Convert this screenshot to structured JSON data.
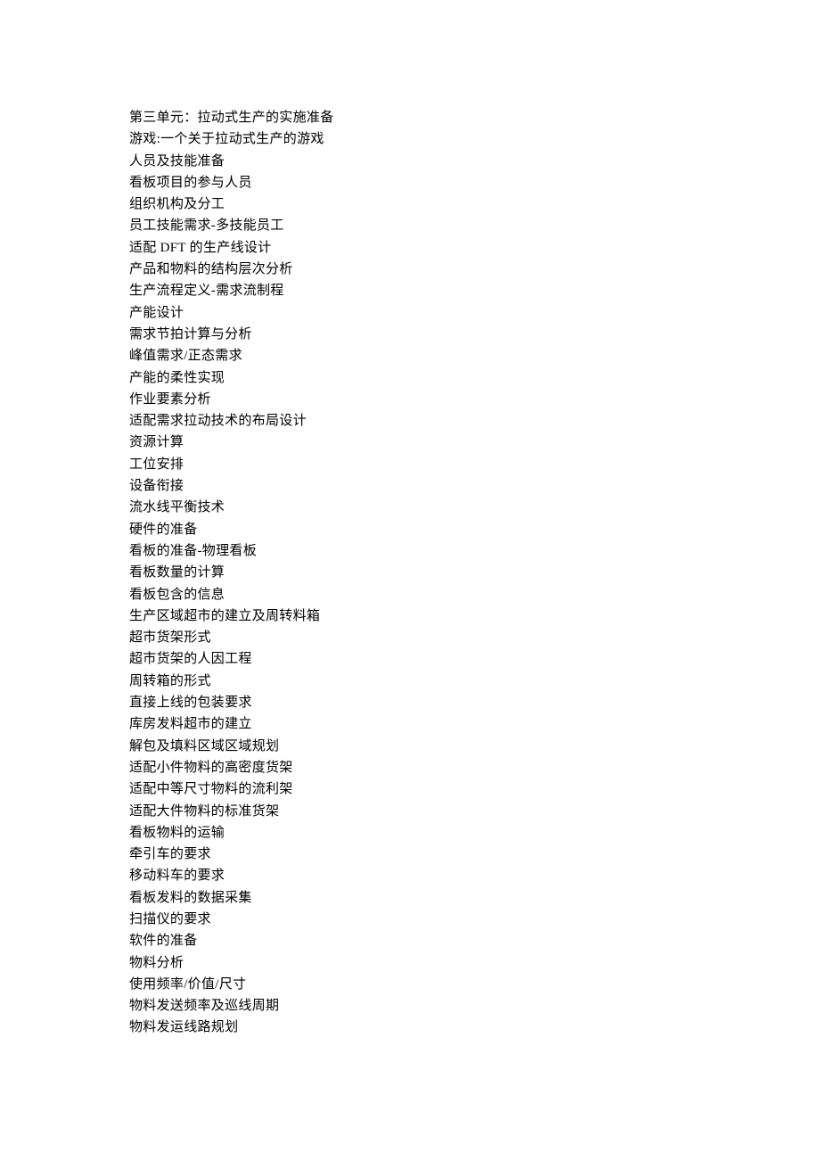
{
  "lines": [
    "第三单元：拉动式生产的实施准备",
    "游戏:一个关于拉动式生产的游戏",
    "人员及技能准备",
    "看板项目的参与人员",
    "组织机构及分工",
    "员工技能需求-多技能员工",
    "适配 DFT 的生产线设计",
    "产品和物料的结构层次分析",
    "生产流程定义-需求流制程",
    "产能设计",
    "需求节拍计算与分析",
    "峰值需求/正态需求",
    "产能的柔性实现",
    "作业要素分析",
    "适配需求拉动技术的布局设计",
    "资源计算",
    "工位安排",
    "设备衔接",
    "流水线平衡技术",
    "硬件的准备",
    "看板的准备-物理看板",
    "看板数量的计算",
    "看板包含的信息",
    "生产区域超市的建立及周转料箱",
    "超市货架形式",
    "超市货架的人因工程",
    "周转箱的形式",
    "直接上线的包装要求",
    "库房发料超市的建立",
    "解包及填料区域区域规划",
    "适配小件物料的高密度货架",
    "适配中等尺寸物料的流利架",
    "适配大件物料的标准货架",
    "看板物料的运输",
    "牵引车的要求",
    "移动料车的要求",
    "看板发料的数据采集",
    "扫描仪的要求",
    "软件的准备",
    "物料分析",
    "使用频率/价值/尺寸",
    "物料发送频率及巡线周期",
    "物料发运线路规划"
  ]
}
